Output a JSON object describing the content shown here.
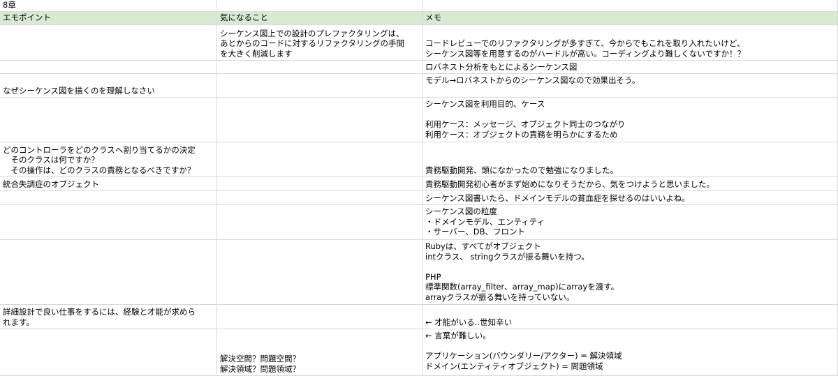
{
  "sheet": {
    "title": "8章",
    "headers": [
      "エモポイント",
      "気になること",
      "メモ"
    ],
    "header_color": "#d9ead3",
    "rows": [
      {
        "a": [],
        "b": [
          "シーケンス図上での設計のプレファクタリングは、",
          "あとからのコードに対するリファクタリングの手間",
          "を大きく削減します"
        ],
        "c": [
          "コードレビューでのリファクタリングが多すぎて、今からでもこれを取り入れたいけど、",
          "シーケンス図等を用意するのがハードルが高い。コーディングより難しくないですか！？"
        ]
      },
      {
        "a": [],
        "b": [],
        "c": [
          "ロバネスト分析をもとによるシーケンス図"
        ]
      },
      {
        "a": [
          "なぜシーケンス図を描くのを理解しなさい"
        ],
        "b": [],
        "c": [
          "モデル→ロバネストからのシーケンス図なので効果出そう。",
          ""
        ]
      },
      {
        "a": [],
        "b": [],
        "c": [
          "シーケンス図を利用目的、ケース",
          "",
          "利用ケース：メッセージ、オブジェクト同士のつながり",
          "利用ケース：オブジェクトの責務を明らかにするため"
        ]
      },
      {
        "a": [
          "どのコントローラをどのクラスへ割り当てるかの決定",
          "　そのクラスは何ですか？",
          "　その操作は、どのクラスの責務となるべきですか？"
        ],
        "b": [],
        "c": [
          "責務駆動開発、頭になかったので勉強になりました。"
        ]
      },
      {
        "a": [
          "統合失調症のオブジェクト"
        ],
        "b": [],
        "c": [
          "責務駆動開発初心者がまず始めになりそうだから、気をつけようと思いました。"
        ]
      },
      {
        "a": [],
        "b": [],
        "c": [
          "シーケンス図書いたら、ドメインモデルの貧血症を探せるのはいいよね。"
        ]
      },
      {
        "a": [],
        "b": [],
        "c": [
          "シーケンス図の粒度",
          "・ドメインモデル、エンティティ",
          "・サーバー、DB、フロント"
        ]
      },
      {
        "a": [],
        "b": [],
        "c": [
          "Rubyは、すべてがオブジェクト",
          "intクラス、 stringクラスが振る舞いを持つ。",
          "",
          "PHP",
          "標準関数(array_filter、array_map)にarrayを渡す。",
          "arrayクラスが振る舞いを持っていない。"
        ]
      },
      {
        "a": [
          "詳細設計で良い仕事をするには、経験と才能が求めら",
          "れます。"
        ],
        "b": [],
        "c": [
          "← 才能がいる..世知辛い"
        ]
      },
      {
        "a": [],
        "b": [
          "解決空間？問題空間？",
          "解決領域？問題領域？"
        ],
        "c": [
          "← 言葉が難しい。",
          "",
          "アプリケーション(バウンダリー/アクター) = 解決領域",
          "ドメイン(エンティティオブジェクト) = 問題領域"
        ]
      }
    ]
  }
}
